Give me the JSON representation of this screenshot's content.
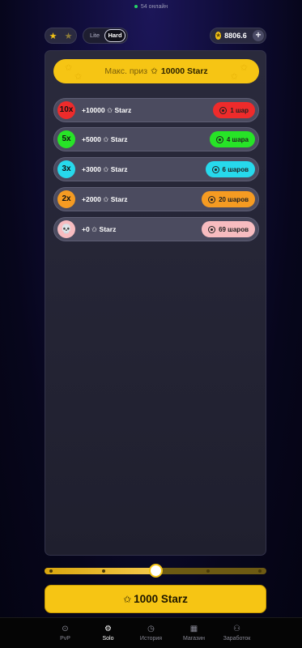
{
  "header": {
    "online_text": "54 онлайн",
    "mode_options": [
      "Lite",
      "Hard"
    ],
    "selected_mode": "Hard",
    "balance": "8806.6"
  },
  "max_prize": {
    "label": "Макс. приз",
    "value": "10000 Starz"
  },
  "prizes": [
    {
      "multiplier": "10x",
      "amount": "+10000 ✩ Starz",
      "badge": "1 шар",
      "color": "#ee2b2b",
      "badge_color": "#ee2b2b"
    },
    {
      "multiplier": "5x",
      "amount": "+5000 ✩ Starz",
      "badge": "4 шара",
      "color": "#27e327",
      "badge_color": "#27e327"
    },
    {
      "multiplier": "3x",
      "amount": "+3000 ✩ Starz",
      "badge": "6 шаров",
      "color": "#27d9ec",
      "badge_color": "#27d9ec"
    },
    {
      "multiplier": "2x",
      "amount": "+2000 ✩ Starz",
      "badge": "20 шаров",
      "color": "#f59b22",
      "badge_color": "#f59b22"
    },
    {
      "multiplier": "skull",
      "amount": "+0 ✩ Starz",
      "badge": "69 шаров",
      "color": "#f7bcc0",
      "badge_color": "#f7bcc0"
    }
  ],
  "slider": {
    "value_fraction": 0.5,
    "tick_count": 5
  },
  "bet_button": {
    "label": "1000 Starz"
  },
  "nav": [
    {
      "label": "PvP",
      "icon": "pvp-icon",
      "active": false
    },
    {
      "label": "Solo",
      "icon": "gear-icon",
      "active": true
    },
    {
      "label": "История",
      "icon": "history-icon",
      "active": false
    },
    {
      "label": "Магазин",
      "icon": "shop-icon",
      "active": false
    },
    {
      "label": "Заработок",
      "icon": "users-icon",
      "active": false
    }
  ]
}
